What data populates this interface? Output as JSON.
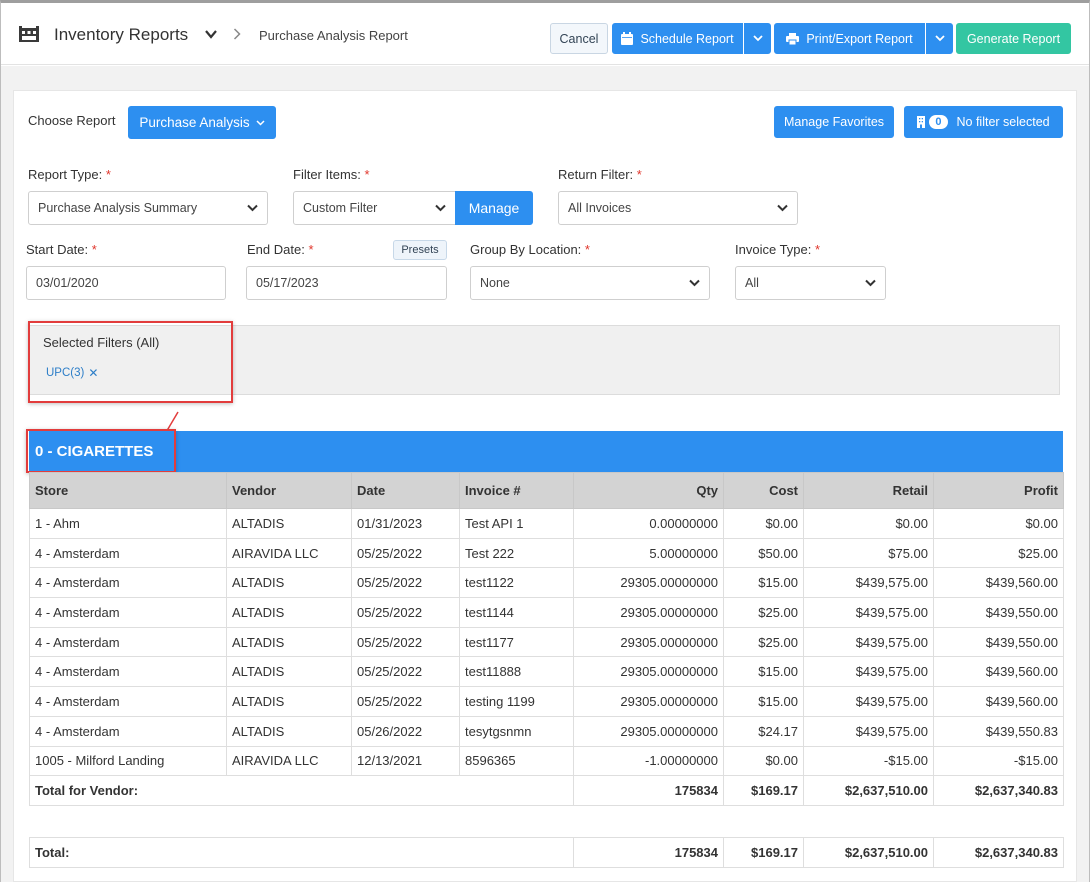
{
  "header": {
    "app_title": "Inventory Reports",
    "breadcrumb": "Purchase Analysis Report",
    "cancel": "Cancel",
    "schedule": "Schedule Report",
    "print": "Print/Export Report",
    "generate": "Generate Report"
  },
  "toolbar": {
    "choose_label": "Choose Report",
    "choose_value": "Purchase Analysis",
    "manage_favorites": "Manage Favorites",
    "filter_count": "0",
    "no_filter": "No filter selected"
  },
  "form": {
    "report_type_label": "Report Type:",
    "report_type_value": "Purchase Analysis Summary",
    "filter_items_label": "Filter Items:",
    "filter_items_value": "Custom Filter",
    "manage": "Manage",
    "return_filter_label": "Return Filter:",
    "return_filter_value": "All Invoices",
    "start_date_label": "Start Date:",
    "start_date_value": "03/01/2020",
    "end_date_label": "End Date:",
    "end_date_value": "05/17/2023",
    "presets": "Presets",
    "group_by_label": "Group By Location:",
    "group_by_value": "None",
    "invoice_type_label": "Invoice Type:",
    "invoice_type_value": "All",
    "required_mark": "*"
  },
  "filters": {
    "title": "Selected Filters (All)",
    "tag": "UPC(3)"
  },
  "group": {
    "title": "0 - CIGARETTES"
  },
  "table": {
    "headers": [
      "Store",
      "Vendor",
      "Date",
      "Invoice #",
      "Qty",
      "Cost",
      "Retail",
      "Profit"
    ],
    "rows": [
      [
        "1 - Ahm",
        "ALTADIS",
        "01/31/2023",
        "Test API 1",
        "0.00000000",
        "$0.00",
        "$0.00",
        "$0.00"
      ],
      [
        "4 - Amsterdam",
        "AIRAVIDA LLC",
        "05/25/2022",
        "Test 222",
        "5.00000000",
        "$50.00",
        "$75.00",
        "$25.00"
      ],
      [
        "4 - Amsterdam",
        "ALTADIS",
        "05/25/2022",
        "test1122",
        "29305.00000000",
        "$15.00",
        "$439,575.00",
        "$439,560.00"
      ],
      [
        "4 - Amsterdam",
        "ALTADIS",
        "05/25/2022",
        "test1144",
        "29305.00000000",
        "$25.00",
        "$439,575.00",
        "$439,550.00"
      ],
      [
        "4 - Amsterdam",
        "ALTADIS",
        "05/25/2022",
        "test1177",
        "29305.00000000",
        "$25.00",
        "$439,575.00",
        "$439,550.00"
      ],
      [
        "4 - Amsterdam",
        "ALTADIS",
        "05/25/2022",
        "test11888",
        "29305.00000000",
        "$15.00",
        "$439,575.00",
        "$439,560.00"
      ],
      [
        "4 - Amsterdam",
        "ALTADIS",
        "05/25/2022",
        "testing 1199",
        "29305.00000000",
        "$15.00",
        "$439,575.00",
        "$439,560.00"
      ],
      [
        "4 - Amsterdam",
        "ALTADIS",
        "05/26/2022",
        "tesytgsnmn",
        "29305.00000000",
        "$24.17",
        "$439,575.00",
        "$439,550.83"
      ],
      [
        "1005 - Milford Landing",
        "AIRAVIDA LLC",
        "12/13/2021",
        "8596365",
        "-1.00000000",
        "$0.00",
        "-$15.00",
        "-$15.00"
      ]
    ],
    "vendor_total": {
      "label": "Total for Vendor:",
      "qty": "175834",
      "cost": "$169.17",
      "retail": "$2,637,510.00",
      "profit": "$2,637,340.83"
    },
    "grand_total": {
      "label": "Total:",
      "qty": "175834",
      "cost": "$169.17",
      "retail": "$2,637,510.00",
      "profit": "$2,637,340.83"
    }
  },
  "colors": {
    "primary": "#2d8ff0",
    "success": "#33c6a2",
    "highlight": "#e23c3c"
  }
}
